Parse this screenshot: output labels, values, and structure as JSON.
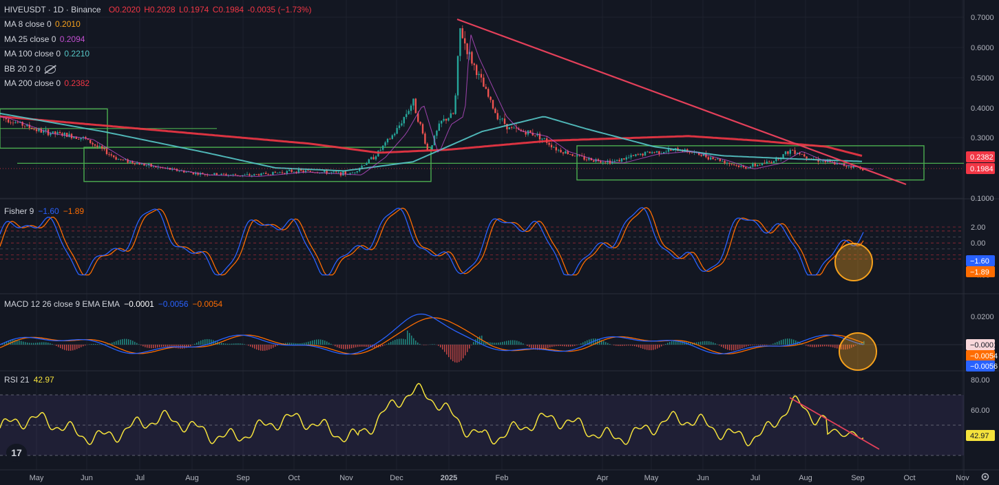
{
  "header": {
    "symbol": "HIVEUSDT · 1D · Binance",
    "o": "O0.2020",
    "h": "H0.2028",
    "l": "L0.1974",
    "c": "C0.1984",
    "chg": "-0.0035 (−1.73%)"
  },
  "indicators": [
    {
      "label": "MA 8 close 0",
      "value": "0.2010",
      "color": "#f7a21c"
    },
    {
      "label": "MA 25 close 0",
      "value": "0.2094",
      "color": "#c24fd1"
    },
    {
      "label": "MA 100 close 0",
      "value": "0.2210",
      "color": "#56c8c8"
    },
    {
      "label": "BB 20 2 0",
      "value": "",
      "color": "#b2b5be"
    },
    {
      "label": "MA 200 close 0",
      "value": "0.2382",
      "color": "#f23645"
    }
  ],
  "fisher": {
    "label": "Fisher 9",
    "v1": "−1.60",
    "v2": "−1.89",
    "c1": "#2962ff",
    "c2": "#ff6d00"
  },
  "macd": {
    "label": "MACD 12 26 close 9 EMA EMA",
    "v1": "−0.0001",
    "v2": "−0.0056",
    "v3": "−0.0054"
  },
  "rsi": {
    "label": "RSI 21",
    "value": "42.97"
  },
  "logo": "17",
  "colors": {
    "bg": "#131722",
    "grid": "#1e222d",
    "up": "#26a69a",
    "down": "#ef5350",
    "trend": "#e4405a",
    "box": "#4caf50",
    "rsi": "#f5e23c"
  },
  "chart_data": {
    "type": "candlestick",
    "x_labels": [
      "May",
      "Jun",
      "Jul",
      "Aug",
      "Sep",
      "Oct",
      "Nov",
      "Dec",
      "2025",
      "Feb",
      "Apr",
      "May",
      "Jun",
      "Jul",
      "Aug",
      "Sep",
      "Oct",
      "Nov"
    ],
    "price_axis": {
      "ticks": [
        "0.7000",
        "0.6000",
        "0.5000",
        "0.4000",
        "0.3000",
        "0.1000"
      ],
      "ylim": [
        0.08,
        0.72
      ]
    },
    "price_tags": [
      {
        "text": "0.2382",
        "bg": "#f23645"
      },
      {
        "text": "0.1984",
        "bg": "#f23645"
      }
    ],
    "fisher_axis": {
      "ticks": [
        "2.00",
        "0.00",
        "−2.00",
        "−4.00"
      ]
    },
    "fisher_tags": [
      {
        "text": "−1.60",
        "bg": "#2962ff"
      },
      {
        "text": "−1.89",
        "bg": "#ff6d00"
      }
    ],
    "macd_axis": {
      "ticks": [
        "0.0200"
      ]
    },
    "macd_tags": [
      {
        "text": "−0.0001",
        "bg": "#f8d7da",
        "fg": "#131722"
      },
      {
        "text": "−0.0054",
        "bg": "#ff6d00",
        "fg": "#ffffff"
      },
      {
        "text": "−0.0056",
        "bg": "#2962ff",
        "fg": "#ffffff"
      }
    ],
    "rsi_axis": {
      "ticks": [
        "80.00",
        "60.00"
      ]
    },
    "rsi_tags": [
      {
        "text": "42.97",
        "bg": "#f5e23c",
        "fg": "#131722"
      }
    ],
    "price_anchors": [
      [
        0,
        0.37
      ],
      [
        60,
        0.32
      ],
      [
        120,
        0.3
      ],
      [
        170,
        0.23
      ],
      [
        220,
        0.205
      ],
      [
        290,
        0.18
      ],
      [
        360,
        0.175
      ],
      [
        430,
        0.19
      ],
      [
        510,
        0.18
      ],
      [
        545,
        0.24
      ],
      [
        575,
        0.32
      ],
      [
        600,
        0.42
      ],
      [
        622,
        0.25
      ],
      [
        640,
        0.35
      ],
      [
        660,
        0.38
      ],
      [
        668,
        0.66
      ],
      [
        680,
        0.58
      ],
      [
        700,
        0.48
      ],
      [
        720,
        0.38
      ],
      [
        740,
        0.33
      ],
      [
        780,
        0.31
      ],
      [
        810,
        0.26
      ],
      [
        850,
        0.23
      ],
      [
        890,
        0.22
      ],
      [
        940,
        0.25
      ],
      [
        990,
        0.26
      ],
      [
        1040,
        0.23
      ],
      [
        1080,
        0.2
      ],
      [
        1120,
        0.22
      ],
      [
        1150,
        0.26
      ],
      [
        1180,
        0.23
      ],
      [
        1210,
        0.215
      ],
      [
        1255,
        0.198
      ]
    ],
    "fisher_value": -1.6,
    "fisher_signal": -1.89,
    "rsi_value": 42.97,
    "ma200_anchors": [
      [
        0,
        0.37
      ],
      [
        150,
        0.34
      ],
      [
        300,
        0.31
      ],
      [
        450,
        0.28
      ],
      [
        550,
        0.25
      ],
      [
        650,
        0.26
      ],
      [
        800,
        0.29
      ],
      [
        1000,
        0.305
      ],
      [
        1100,
        0.29
      ],
      [
        1200,
        0.27
      ],
      [
        1255,
        0.238
      ]
    ],
    "ma100_anchors": [
      [
        0,
        0.38
      ],
      [
        150,
        0.32
      ],
      [
        300,
        0.25
      ],
      [
        400,
        0.2
      ],
      [
        500,
        0.19
      ],
      [
        600,
        0.22
      ],
      [
        700,
        0.32
      ],
      [
        790,
        0.37
      ],
      [
        850,
        0.33
      ],
      [
        950,
        0.27
      ],
      [
        1050,
        0.24
      ],
      [
        1150,
        0.23
      ],
      [
        1255,
        0.221
      ]
    ]
  }
}
